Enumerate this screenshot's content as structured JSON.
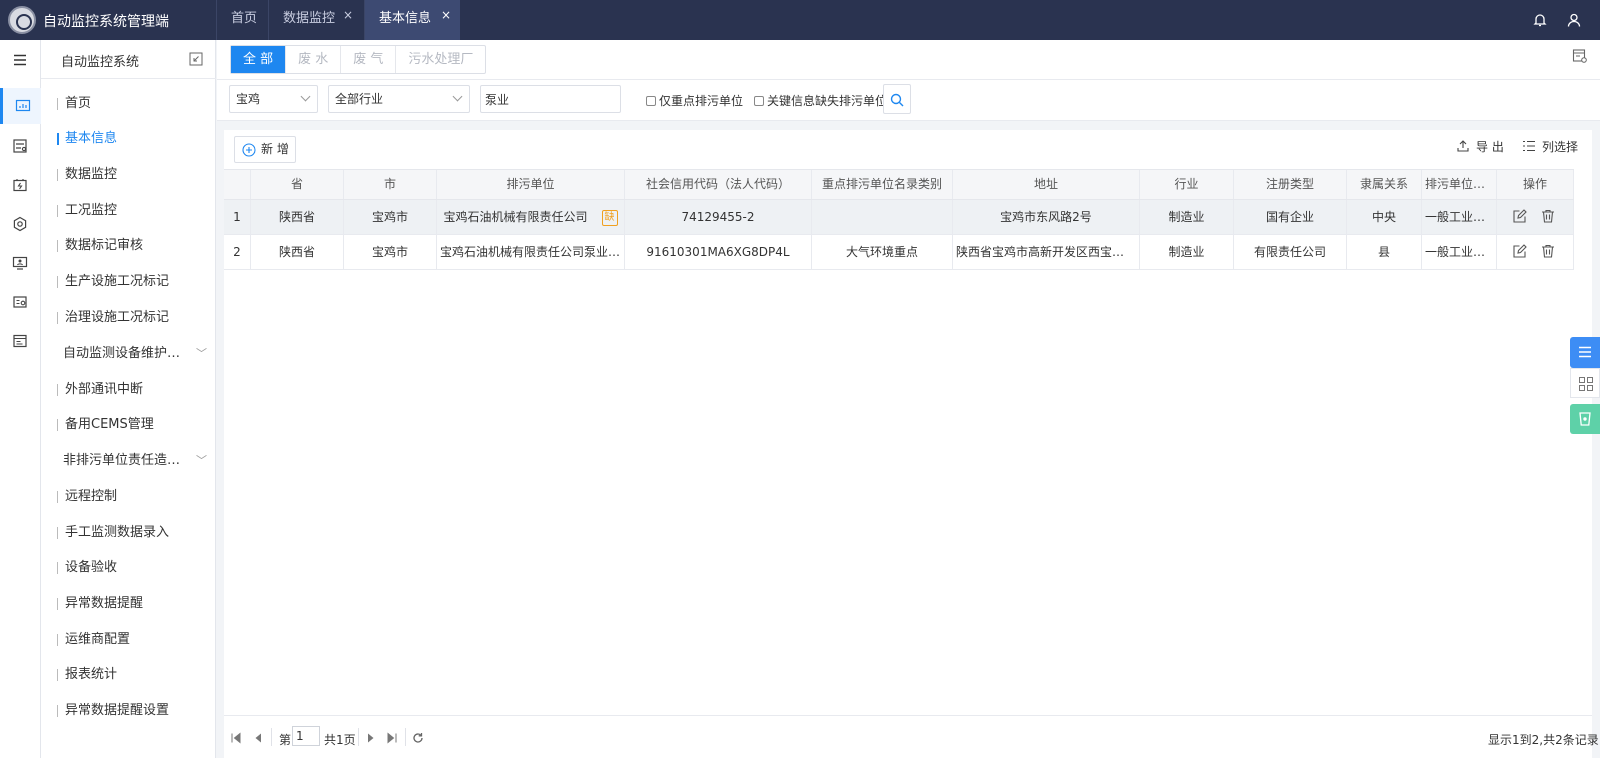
{
  "app": {
    "title": "自动监控系统管理端"
  },
  "top_tabs": [
    {
      "label": "首页",
      "closable": false,
      "active": false
    },
    {
      "label": "数据监控",
      "closable": true,
      "active": false
    },
    {
      "label": "基本信息",
      "closable": true,
      "active": true
    }
  ],
  "close_glyph": "×",
  "sidebar": {
    "title": "自动监控系统",
    "items": [
      {
        "label": "首页"
      },
      {
        "label": "基本信息",
        "active": true
      },
      {
        "label": "数据监控"
      },
      {
        "label": "工况监控"
      },
      {
        "label": "数据标记审核"
      },
      {
        "label": "生产设施工况标记"
      },
      {
        "label": "治理设施工况标记"
      },
      {
        "label": "自动监测设备维护…",
        "group": true
      },
      {
        "label": "外部通讯中断"
      },
      {
        "label": "备用CEMS管理"
      },
      {
        "label": "非排污单位责任造…",
        "group": true
      },
      {
        "label": "远程控制"
      },
      {
        "label": "手工监测数据录入"
      },
      {
        "label": "设备验收"
      },
      {
        "label": "异常数据提醒"
      },
      {
        "label": "运维商配置"
      },
      {
        "label": "报表统计"
      },
      {
        "label": "异常数据提醒设置"
      }
    ]
  },
  "filter_tabs": [
    {
      "label": "全 部",
      "active": true
    },
    {
      "label": "废 水"
    },
    {
      "label": "废 气"
    },
    {
      "label": "污水处理厂"
    }
  ],
  "search": {
    "city": "宝鸡",
    "industry": "全部行业",
    "keyword": "泵业",
    "key_only_label": "仅重点排污单位",
    "missing_info_label": "关键信息缺失排污单位"
  },
  "toolbar": {
    "add_label": "新 增",
    "export_label": "导 出",
    "columns_label": "列选择"
  },
  "table": {
    "columns": [
      "省",
      "市",
      "排污单位",
      "社会信用代码（法人代码）",
      "重点排污单位名录类别",
      "地址",
      "行业",
      "注册类型",
      "隶属关系",
      "排污单位类别",
      "操作"
    ],
    "rows": [
      {
        "index": "1",
        "province": "陕西省",
        "city": "宝鸡市",
        "unit": "宝鸡石油机械有限责任公司",
        "flag": "缺",
        "credit_code": "74129455-2",
        "key_category": "",
        "address": "宝鸡市东风路2号",
        "industry": "制造业",
        "reg_type": "国有企业",
        "affiliation": "中央",
        "unit_category": "一般工业企…"
      },
      {
        "index": "2",
        "province": "陕西省",
        "city": "宝鸡市",
        "unit": "宝鸡石油机械有限责任公司泵业分…",
        "flag": "",
        "credit_code": "91610301MA6XG8DP4L",
        "key_category": "大气环境重点",
        "address": "陕西省宝鸡市高新开发区西宝路3…",
        "industry": "制造业",
        "reg_type": "有限责任公司",
        "affiliation": "县",
        "unit_category": "一般工业企…"
      }
    ]
  },
  "pager": {
    "prefix": "第",
    "page": "1",
    "total_pages": "共1页",
    "summary": "显示1到2,共2条记录"
  },
  "colors": {
    "topbar": "#2a3350",
    "accent": "#1e87f0",
    "flag": "#f0a020"
  }
}
